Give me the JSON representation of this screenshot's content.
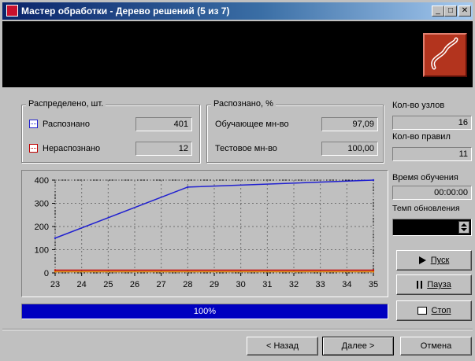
{
  "window": {
    "title": "Мастер обработки - Дерево решений (5 из 7)",
    "controls": {
      "minimize": "_",
      "maximize": "□",
      "close": "✕"
    }
  },
  "distributed": {
    "title": "Распределено, шт.",
    "recognized_label": "Распознано",
    "recognized_value": "401",
    "unrecognized_label": "Нераспознано",
    "unrecognized_value": "12"
  },
  "recognized_pct": {
    "title": "Распознано, %",
    "training_label": "Обучающее мн-во",
    "training_value": "97,09",
    "test_label": "Тестовое мн-во",
    "test_value": "100,00"
  },
  "stats": {
    "nodes_label": "Кол-во узлов",
    "nodes_value": "16",
    "rules_label": "Кол-во правил",
    "rules_value": "11",
    "time_label": "Время обучения",
    "time_value": "00:00:00",
    "rate_label": "Темп обновления"
  },
  "actions": {
    "start": "Пуск",
    "pause": "Пауза",
    "stop": "Стоп"
  },
  "progress": {
    "text": "100%",
    "fraction": 1.0
  },
  "footer": {
    "back": "< Назад",
    "next": "Далее >",
    "cancel": "Отмена"
  },
  "colors": {
    "series_blue": "#2020d0",
    "series_red": "#c00000",
    "series_orange": "#e08000"
  },
  "chart_data": {
    "type": "line",
    "x": [
      23,
      24,
      25,
      26,
      27,
      28,
      29,
      30,
      31,
      32,
      33,
      34,
      35
    ],
    "xticks": [
      "23",
      "24",
      "25",
      "26",
      "27",
      "28",
      "29",
      "30",
      "31",
      "32",
      "33",
      "34",
      "35"
    ],
    "yticks": [
      "0",
      "100",
      "200",
      "300",
      "400"
    ],
    "xlim": [
      23,
      35
    ],
    "ylim": [
      0,
      400
    ],
    "grid": true,
    "series": [
      {
        "color": "#2020d0",
        "x": [
          23,
          28,
          35
        ],
        "y": [
          150,
          370,
          400
        ]
      },
      {
        "color": "#c00000",
        "x": [
          23,
          35
        ],
        "y": [
          12,
          12
        ]
      },
      {
        "color": "#e08000",
        "x": [
          23,
          35
        ],
        "y": [
          5,
          5
        ]
      }
    ]
  }
}
